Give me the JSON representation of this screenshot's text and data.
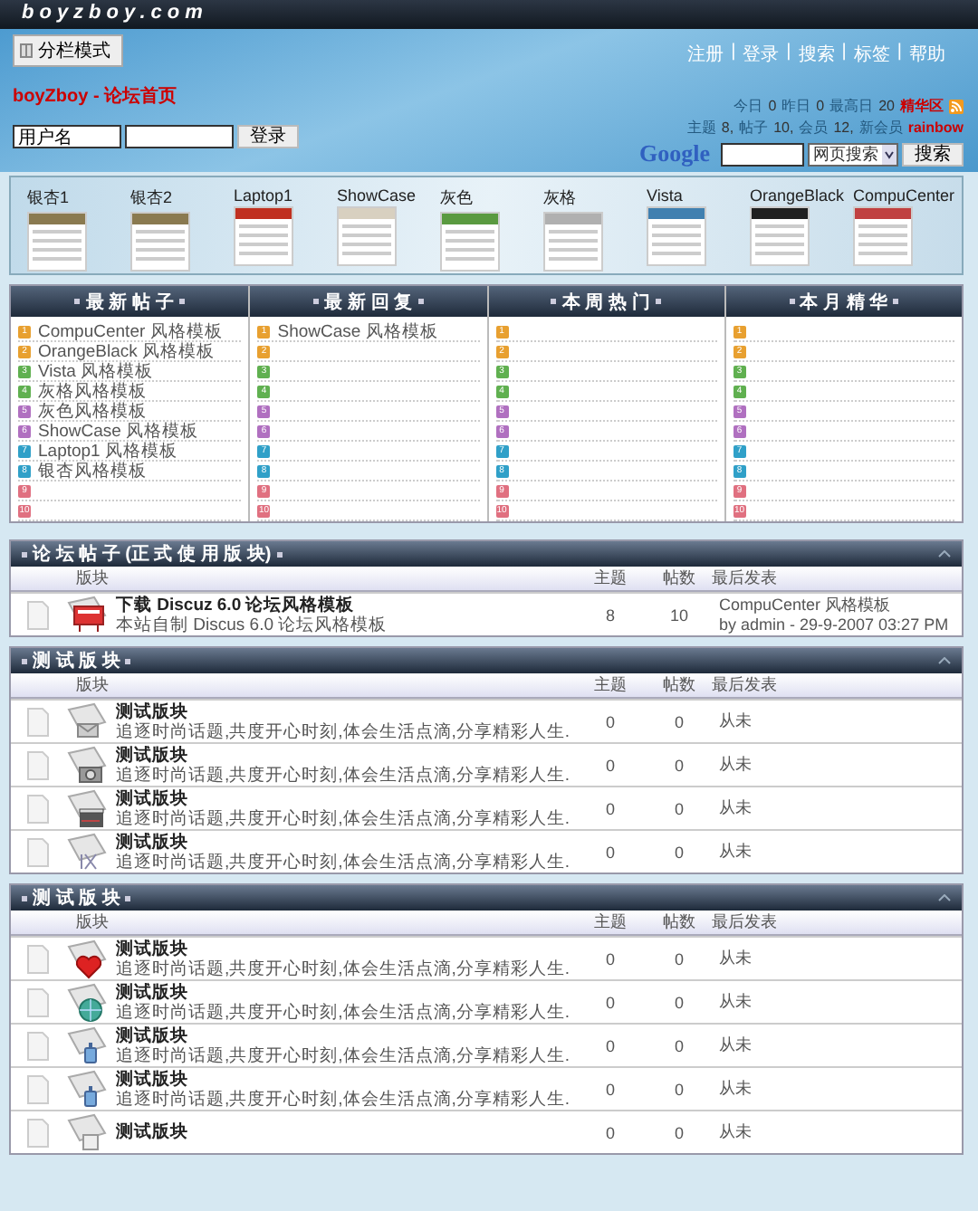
{
  "header": {
    "logo": "boyzboy.com",
    "mode_button": "分栏模式",
    "links": [
      {
        "label": "注册"
      },
      {
        "label": "登录"
      },
      {
        "label": "搜索"
      },
      {
        "label": "标签"
      },
      {
        "label": "帮助"
      }
    ],
    "separator": "|",
    "breadcrumb": "boyZboy - 论坛首页",
    "login": {
      "username_value": "用户名",
      "button": "登录"
    },
    "stats_line1": [
      {
        "label": "今日",
        "value": "0"
      },
      {
        "label": "昨日",
        "value": "0"
      },
      {
        "label": "最高日",
        "value": "20"
      }
    ],
    "digest_link": "精华区",
    "stats_line2": [
      {
        "label": "主题",
        "value": "8,"
      },
      {
        "label": "帖子",
        "value": "10,"
      },
      {
        "label": "会员",
        "value": "12,"
      }
    ],
    "new_member_label": "新会员",
    "new_member": "rainbow",
    "google": {
      "logo": "Google",
      "select": "网页搜索",
      "button": "搜索"
    }
  },
  "themes": [
    {
      "label": "银杏1",
      "color": "#8a7a50"
    },
    {
      "label": "银杏2",
      "color": "#8a7a50"
    },
    {
      "label": "Laptop1",
      "color": "#c03020"
    },
    {
      "label": "ShowCase",
      "color": "#d8d0c0"
    },
    {
      "label": "灰色",
      "color": "#5a9a40"
    },
    {
      "label": "灰格",
      "color": "#b0b0b0"
    },
    {
      "label": "Vista",
      "color": "#4080b0"
    },
    {
      "label": "OrangeBlack",
      "color": "#202020"
    },
    {
      "label": "CompuCenter",
      "color": "#c04040"
    }
  ],
  "columns": [
    {
      "title": "最 新 帖 子",
      "items": [
        "CompuCenter 风格模板",
        "OrangeBlack 风格模板",
        "Vista 风格模板",
        "灰格风格模板",
        "灰色风格模板",
        "ShowCase 风格模板",
        "Laptop1 风格模板",
        "银杏风格模板"
      ],
      "ranks": [
        {
          "num": "1",
          "color": "#e8a030"
        },
        {
          "num": "2",
          "color": "#e8a030"
        },
        {
          "num": "3",
          "color": "#60b050"
        },
        {
          "num": "4",
          "color": "#60b050"
        },
        {
          "num": "5",
          "color": "#b070c0"
        },
        {
          "num": "6",
          "color": "#b070c0"
        },
        {
          "num": "7",
          "color": "#30a0c8"
        },
        {
          "num": "8",
          "color": "#30a0c8"
        },
        {
          "num": "9",
          "color": "#e07080"
        },
        {
          "num": "10",
          "color": "#e07080"
        }
      ]
    },
    {
      "title": "最 新 回 复",
      "items": [
        "ShowCase 风格模板"
      ],
      "ranks": [
        {
          "num": "1",
          "color": "#e8a030"
        },
        {
          "num": "2",
          "color": "#e8a030"
        },
        {
          "num": "3",
          "color": "#60b050"
        },
        {
          "num": "4",
          "color": "#60b050"
        },
        {
          "num": "5",
          "color": "#b070c0"
        },
        {
          "num": "6",
          "color": "#b070c0"
        },
        {
          "num": "7",
          "color": "#30a0c8"
        },
        {
          "num": "8",
          "color": "#30a0c8"
        },
        {
          "num": "9",
          "color": "#e07080"
        },
        {
          "num": "10",
          "color": "#e07080"
        }
      ]
    },
    {
      "title": "本 周 热 门",
      "ranks": [
        {
          "num": "1",
          "color": "#e8a030"
        },
        {
          "num": "2",
          "color": "#e8a030"
        },
        {
          "num": "3",
          "color": "#60b050"
        },
        {
          "num": "4",
          "color": "#60b050"
        },
        {
          "num": "5",
          "color": "#b070c0"
        },
        {
          "num": "6",
          "color": "#b070c0"
        },
        {
          "num": "7",
          "color": "#30a0c8"
        },
        {
          "num": "8",
          "color": "#30a0c8"
        },
        {
          "num": "9",
          "color": "#e07080"
        },
        {
          "num": "10",
          "color": "#e07080"
        }
      ]
    },
    {
      "title": "本 月 精 华",
      "ranks": [
        {
          "num": "1",
          "color": "#e8a030"
        },
        {
          "num": "2",
          "color": "#e8a030"
        },
        {
          "num": "3",
          "color": "#60b050"
        },
        {
          "num": "4",
          "color": "#60b050"
        },
        {
          "num": "5",
          "color": "#b070c0"
        },
        {
          "num": "6",
          "color": "#b070c0"
        },
        {
          "num": "7",
          "color": "#30a0c8"
        },
        {
          "num": "8",
          "color": "#30a0c8"
        },
        {
          "num": "9",
          "color": "#e07080"
        },
        {
          "num": "10",
          "color": "#e07080"
        }
      ]
    }
  ],
  "sections": [
    {
      "title": "论 坛 帖 子 (正 式 使 用 版 块)",
      "columns": [
        "版块",
        "主题",
        "帖数",
        "最后发表"
      ],
      "forums": [
        {
          "kind": "billboard",
          "name": "下载  Discuz 6.0 论坛风格模板",
          "desc": "本站自制  Discus 6.0 论坛风格模板",
          "topics": "8",
          "posts": "10",
          "last": "CompuCenter 风格模板",
          "last_by": "by admin - 29-9-2007 03:27 PM"
        }
      ]
    },
    {
      "title": "测 试 版 块",
      "columns": [
        "版块",
        "主题",
        "帖数",
        "最后发表"
      ],
      "forums": [
        {
          "kind": "envelope",
          "name": "测试版块",
          "desc": "追逐时尚话题,共度开心时刻,体会生活点滴,分享精彩人生.",
          "topics": "0",
          "posts": "0",
          "last": "从未"
        },
        {
          "kind": "camera",
          "name": "测试版块",
          "desc": "追逐时尚话题,共度开心时刻,体会生活点滴,分享精彩人生.",
          "topics": "0",
          "posts": "0",
          "last": "从未"
        },
        {
          "kind": "clapper",
          "name": "测试版块",
          "desc": "追逐时尚话题,共度开心时刻,体会生活点滴,分享精彩人生.",
          "topics": "0",
          "posts": "0",
          "last": "从未"
        },
        {
          "kind": "letter",
          "name": "测试版块",
          "desc": "追逐时尚话题,共度开心时刻,体会生活点滴,分享精彩人生.",
          "topics": "0",
          "posts": "0",
          "last": "从未"
        }
      ]
    },
    {
      "title": "测 试 版 块",
      "columns": [
        "版块",
        "主题",
        "帖数",
        "最后发表"
      ],
      "forums": [
        {
          "kind": "heart",
          "name": "测试版块",
          "desc": "追逐时尚话题,共度开心时刻,体会生活点滴,分享精彩人生.",
          "topics": "0",
          "posts": "0",
          "last": "从未"
        },
        {
          "kind": "globe",
          "name": "测试版块",
          "desc": "追逐时尚话题,共度开心时刻,体会生活点滴,分享精彩人生.",
          "topics": "0",
          "posts": "0",
          "last": "从未"
        },
        {
          "kind": "bottle",
          "name": "测试版块",
          "desc": "追逐时尚话题,共度开心时刻,体会生活点滴,分享精彩人生.",
          "topics": "0",
          "posts": "0",
          "last": "从未"
        },
        {
          "kind": "bottle",
          "name": "测试版块",
          "desc": "追逐时尚话题,共度开心时刻,体会生活点滴,分享精彩人生.",
          "topics": "0",
          "posts": "0",
          "last": "从未"
        },
        {
          "kind": "document",
          "name": "测试版块",
          "topics": "0",
          "posts": "0",
          "last": "从未"
        }
      ]
    }
  ]
}
